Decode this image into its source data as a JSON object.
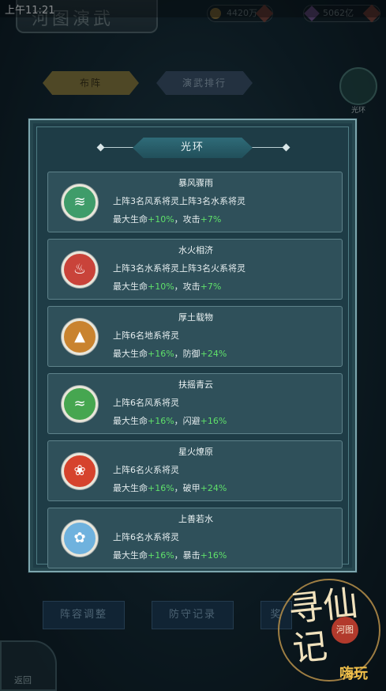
{
  "status_bar": {
    "time": "上午11:21"
  },
  "header": {
    "title_text": "河图演武",
    "currency_1": "4420万",
    "currency_2": "5062亿"
  },
  "tabs": [
    {
      "label": "布阵"
    },
    {
      "label": "演武排行"
    }
  ],
  "corner_badge": {
    "label": "光环"
  },
  "bottom_buttons": [
    {
      "label": "阵容调整"
    },
    {
      "label": "防守记录"
    },
    {
      "label": "奖"
    }
  ],
  "back_button": {
    "label": "返回"
  },
  "watermark": {
    "big_text": "寻仙记",
    "seal_text": "河图",
    "corner_text": "嗨玩"
  },
  "panel": {
    "title": "光环",
    "cards": [
      {
        "title": "暴风骤雨",
        "desc": "上阵3名风系将灵上阵3名水系将灵",
        "stat1_label": "最大生命",
        "stat1_value": "+10%",
        "stat2_label": "攻击",
        "stat2_value": "+7%",
        "icon": "wind-water-icon",
        "color": "#3f9c6a"
      },
      {
        "title": "水火相济",
        "desc": "上阵3名水系将灵上阵3名火系将灵",
        "stat1_label": "最大生命",
        "stat1_value": "+10%",
        "stat2_label": "攻击",
        "stat2_value": "+7%",
        "icon": "water-fire-icon",
        "color": "#c9433a"
      },
      {
        "title": "厚土载物",
        "desc": "上阵6名地系将灵",
        "stat1_label": "最大生命",
        "stat1_value": "+16%",
        "stat2_label": "防御",
        "stat2_value": "+24%",
        "icon": "earth-mountain-icon",
        "color": "#c9832f"
      },
      {
        "title": "扶摇青云",
        "desc": "上阵6名风系将灵",
        "stat1_label": "最大生命",
        "stat1_value": "+16%",
        "stat2_label": "闪避",
        "stat2_value": "+16%",
        "icon": "wind-tornado-icon",
        "color": "#46a650"
      },
      {
        "title": "星火燎原",
        "desc": "上阵6名火系将灵",
        "stat1_label": "最大生命",
        "stat1_value": "+16%",
        "stat2_label": "破甲",
        "stat2_value": "+24%",
        "icon": "fire-flame-icon",
        "color": "#d6432d"
      },
      {
        "title": "上善若水",
        "desc": "上阵6名水系将灵",
        "stat1_label": "最大生命",
        "stat1_value": "+16%",
        "stat2_label": "暴击",
        "stat2_value": "+16%",
        "icon": "water-lotus-icon",
        "color": "#6fb2de"
      }
    ]
  }
}
